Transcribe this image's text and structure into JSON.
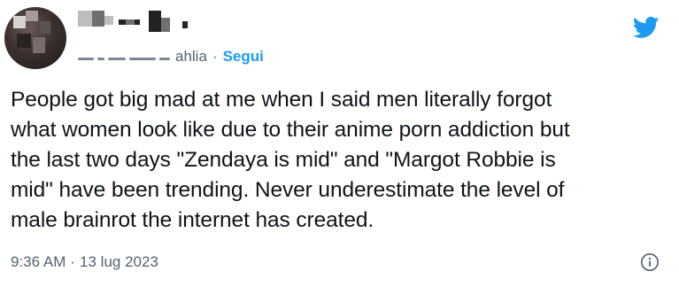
{
  "header": {
    "handle_suffix": "ahlia",
    "separator": "·",
    "follow_label": "Segui"
  },
  "tweet": {
    "text": "People got big mad at me when I said men literally forgot\nwhat women look like due to their anime porn addiction but\nthe last two days \"Zendaya is mid\" and \"Margot Robbie is\nmid\" have been trending. Never underestimate the level of\nmale brainrot the internet has created."
  },
  "meta": {
    "time": "9:36 AM",
    "separator": "·",
    "date": "13 lug 2023"
  },
  "icons": {
    "brand": "twitter-bird-icon",
    "info": "info-icon"
  },
  "colors": {
    "accent": "#1d9bf0",
    "text": "#0f1419",
    "secondary": "#536471"
  }
}
